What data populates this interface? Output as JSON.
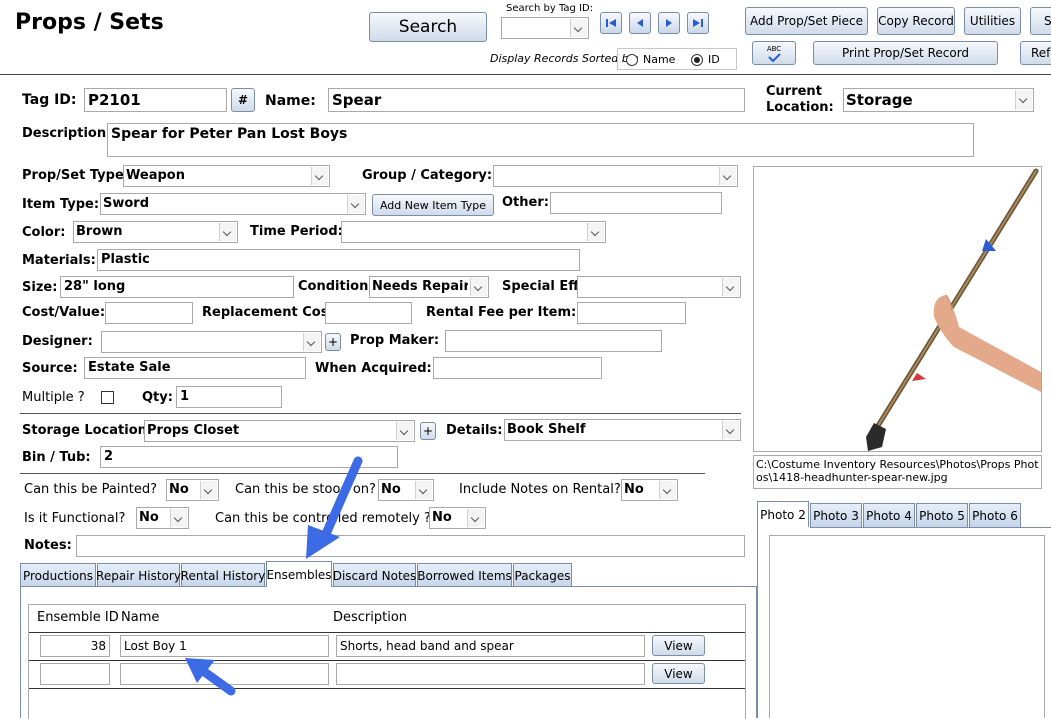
{
  "header": {
    "title": "Props / Sets",
    "search_label": "Search",
    "search_by_tag_label": "Search by Tag ID:",
    "sorted_by_label": "Display Records Sorted by:",
    "sort_name": "Name",
    "sort_id": "ID",
    "add_button": "Add Prop/Set Piece",
    "copy_button": "Copy Record",
    "utilities_button": "Utilities",
    "s_button": "S",
    "print_button": "Print Prop/Set Record",
    "refresh_button": "Refr",
    "spell_icon_text": "ABC"
  },
  "record": {
    "tag_label": "Tag ID:",
    "tag_value": "P2101",
    "hash_button": "#",
    "name_label": "Name:",
    "name_value": "Spear",
    "location_label": "Current Location:",
    "location_value": "Storage",
    "description_label": "Description:",
    "description_value": "Spear for Peter Pan Lost Boys",
    "type_label": "Prop/Set Type:",
    "type_value": "Weapon",
    "group_label": "Group / Category:",
    "group_value": "",
    "item_type_label": "Item Type:",
    "item_type_value": "Sword",
    "add_item_type_button": "Add New Item Type",
    "other_label": "Other:",
    "other_value": "",
    "color_label": "Color:",
    "color_value": "Brown",
    "time_period_label": "Time Period:",
    "time_period_value": "",
    "materials_label": "Materials:",
    "materials_value": "Plastic",
    "size_label": "Size:",
    "size_value": "28\" long",
    "condition_label": "Condition:",
    "condition_value": "Needs Repair",
    "special_effect_label": "Special Effect:",
    "special_effect_value": "",
    "cost_label": "Cost/Value:",
    "cost_value": "",
    "replacement_label": "Replacement Cost:",
    "replacement_value": "",
    "rental_fee_label": "Rental Fee per Item:",
    "rental_fee_value": "",
    "designer_label": "Designer:",
    "designer_value": "",
    "plus": "+",
    "prop_maker_label": "Prop Maker:",
    "prop_maker_value": "",
    "source_label": "Source:",
    "source_value": "Estate Sale",
    "when_acquired_label": "When Acquired:",
    "when_acquired_value": "",
    "multiple_label": "Multiple ?",
    "qty_label": "Qty:",
    "qty_value": "1",
    "storage_label": "Storage Location:",
    "storage_value": "Props Closet",
    "details_label": "Details:",
    "details_value": "Book Shelf",
    "bin_label": "Bin / Tub:",
    "bin_value": "2",
    "painted_label": "Can this be Painted?",
    "painted_value": "No",
    "stood_label": "Can this be stood on?",
    "stood_value": "No",
    "include_notes_label": "Include Notes on Rental?",
    "include_notes_value": "No",
    "functional_label": "Is it Functional?",
    "functional_value": "No",
    "remote_label": "Can this be controlled remotely ?",
    "remote_value": "No",
    "notes_label": "Notes:",
    "notes_value": ""
  },
  "photo": {
    "path": "C:\\Costume Inventory Resources\\Photos\\Props Photos\\1418-headhunter-spear-new.jpg",
    "tabs": [
      "Photo 2",
      "Photo 3",
      "Photo 4",
      "Photo 5",
      "Photo 6"
    ]
  },
  "tabs": [
    "Productions",
    "Repair History",
    "Rental History",
    "Ensembles",
    "Discard Notes",
    "Borrowed Items",
    "Packages"
  ],
  "ensembles": {
    "col_id": "Ensemble ID",
    "col_name": "Name",
    "col_desc": "Description",
    "rows": [
      {
        "id": "38",
        "name": "Lost Boy 1",
        "description": "Shorts, head band and spear",
        "view": "View"
      },
      {
        "id": "",
        "name": "",
        "description": "",
        "view": "View"
      }
    ]
  },
  "colors": {
    "arrow": "#3d6be6",
    "button_border": "#7a8ea8",
    "nav_icon": "#2a5bd7"
  }
}
